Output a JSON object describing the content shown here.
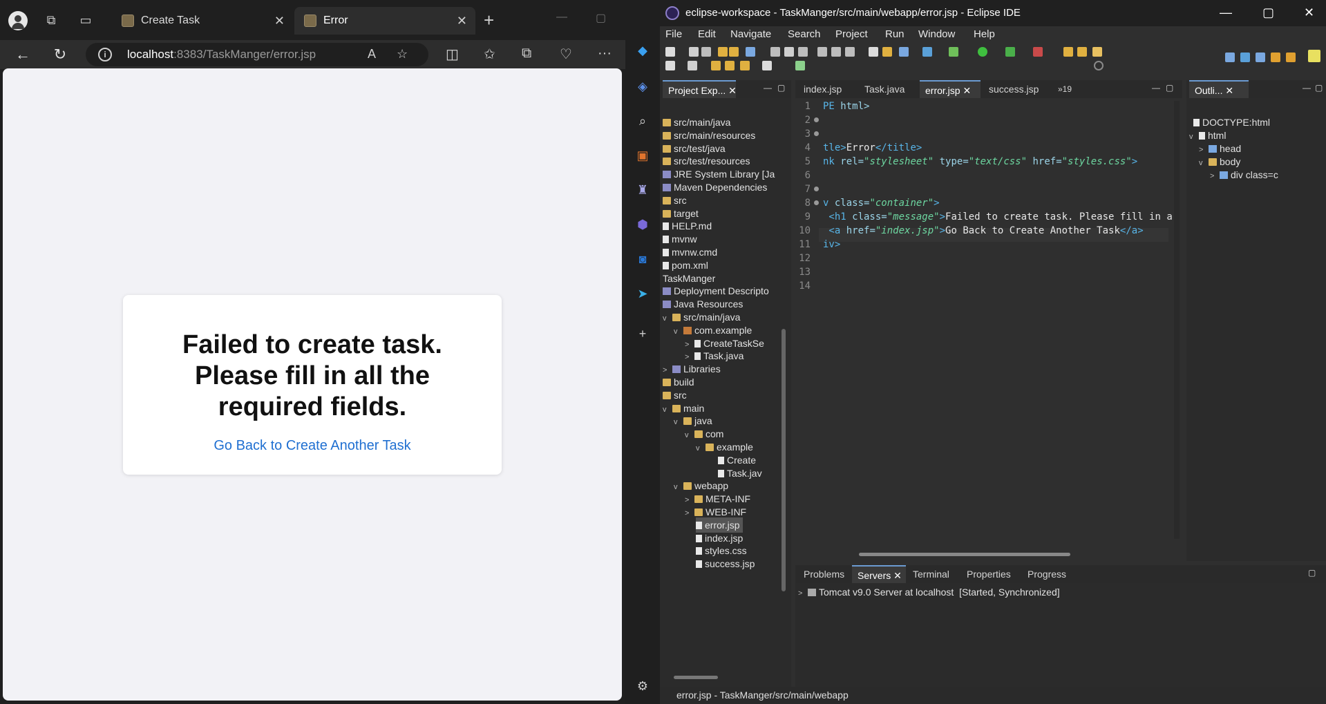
{
  "browser": {
    "tabs": [
      {
        "label": "Create Task",
        "active": false
      },
      {
        "label": "Error",
        "active": true
      }
    ],
    "address": {
      "host": "localhost",
      "rest": ":8383/TaskManger/error.jsp"
    },
    "page": {
      "message": "Failed to create task. Please fill in all the required fields.",
      "link": "Go Back to Create Another Task",
      "link_color": "#1f6fd1"
    }
  },
  "eclipse": {
    "title": "eclipse-workspace - TaskManger/src/main/webapp/error.jsp - Eclipse IDE",
    "menu": [
      "File",
      "Edit",
      "Navigate",
      "Search",
      "Project",
      "Run",
      "Window",
      "Help"
    ],
    "project_explorer": {
      "tab_label": "Project Exp...",
      "items": [
        {
          "label": "src/main/java",
          "icon": "folder"
        },
        {
          "label": "src/main/resources",
          "icon": "folder"
        },
        {
          "label": "src/test/java",
          "icon": "folder"
        },
        {
          "label": "src/test/resources",
          "icon": "folder"
        },
        {
          "label": "JRE System Library [Ja",
          "icon": "jar"
        },
        {
          "label": "Maven Dependencies",
          "icon": "jar"
        },
        {
          "label": "src",
          "icon": "folder"
        },
        {
          "label": "target",
          "icon": "folder"
        },
        {
          "label": "HELP.md",
          "icon": "file"
        },
        {
          "label": "mvnw",
          "icon": "file"
        },
        {
          "label": "mvnw.cmd",
          "icon": "file"
        },
        {
          "label": "pom.xml",
          "icon": "file"
        },
        {
          "label": "TaskManger",
          "icon": "none"
        },
        {
          "label": "Deployment Descripto",
          "icon": "jar"
        },
        {
          "label": "Java Resources",
          "icon": "jar"
        },
        {
          "label": "src/main/java",
          "icon": "folder",
          "twisty": "v"
        },
        {
          "label": "com.example",
          "icon": "package",
          "twisty": "v"
        },
        {
          "label": "CreateTaskSe",
          "icon": "file",
          "twisty": ">"
        },
        {
          "label": "Task.java",
          "icon": "file",
          "twisty": ">"
        },
        {
          "label": "Libraries",
          "icon": "jar",
          "twisty": ">"
        },
        {
          "label": "build",
          "icon": "folder"
        },
        {
          "label": "src",
          "icon": "folder"
        },
        {
          "label": "main",
          "icon": "folder",
          "twisty": "v"
        },
        {
          "label": "java",
          "icon": "folder",
          "twisty": "v"
        },
        {
          "label": "com",
          "icon": "folder",
          "twisty": "v"
        },
        {
          "label": "example",
          "icon": "folder",
          "twisty": "v"
        },
        {
          "label": "Create",
          "icon": "file"
        },
        {
          "label": "Task.jav",
          "icon": "file"
        },
        {
          "label": "webapp",
          "icon": "folder",
          "twisty": "v"
        },
        {
          "label": "META-INF",
          "icon": "folder",
          "twisty": ">"
        },
        {
          "label": "WEB-INF",
          "icon": "folder",
          "twisty": ">"
        },
        {
          "label": "error.jsp",
          "icon": "file",
          "selected": true
        },
        {
          "label": "index.jsp",
          "icon": "file"
        },
        {
          "label": "styles.css",
          "icon": "file"
        },
        {
          "label": "success.jsp",
          "icon": "file"
        }
      ]
    },
    "editor_tabs": [
      {
        "label": "index.jsp",
        "active": false
      },
      {
        "label": "Task.java",
        "active": false
      },
      {
        "label": "error.jsp",
        "active": true
      },
      {
        "label": "success.jsp",
        "active": false
      },
      {
        "label": "»19",
        "active": false
      }
    ],
    "code_lines": [
      "1",
      "2",
      "3",
      "4",
      "5",
      "6",
      "7",
      "8",
      "9",
      "10",
      "11",
      "12",
      "13",
      "14"
    ],
    "code": {
      "l1a": "PE",
      "l1b": " html>",
      "l4a": "tle>",
      "l4b": "Error",
      "l4c": "</title>",
      "l5a": "nk",
      "l5b": " rel=",
      "l5c": "\"stylesheet\"",
      "l5d": " type=",
      "l5e": "\"text/css\"",
      "l5f": " href=",
      "l5g": "\"styles.css\"",
      "l5h": ">",
      "l8a": "v",
      "l8b": " class=",
      "l8c": "\"container\"",
      "l8d": ">",
      "l9a": " <h1",
      "l9b": " class=",
      "l9c": "\"message\"",
      "l9d": ">",
      "l9e": "Failed to create task. Please fill in a",
      "l10a": " <a",
      "l10b": " href=",
      "l10c": "\"index.jsp\"",
      "l10d": ">",
      "l10e": "Go Back to Create Another Task",
      "l10f": "</a>",
      "l11a": "iv",
      "l11b": ">"
    },
    "outline": {
      "tab_label": "Outli...",
      "items": [
        {
          "label": "DOCTYPE:html"
        },
        {
          "label": "html",
          "twisty": "v"
        },
        {
          "label": "head",
          "twisty": ">"
        },
        {
          "label": "body",
          "twisty": "v"
        },
        {
          "label": "div class=c",
          "twisty": ">"
        }
      ]
    },
    "bottom_tabs": [
      {
        "label": "Problems",
        "active": false
      },
      {
        "label": "Servers",
        "active": true
      },
      {
        "label": "Terminal",
        "active": false
      },
      {
        "label": "Properties",
        "active": false
      },
      {
        "label": "Progress",
        "active": false
      }
    ],
    "server": {
      "name": "Tomcat v9.0 Server at localhost",
      "state": "[Started, Synchronized]"
    },
    "status": "error.jsp - TaskManger/src/main/webapp"
  }
}
